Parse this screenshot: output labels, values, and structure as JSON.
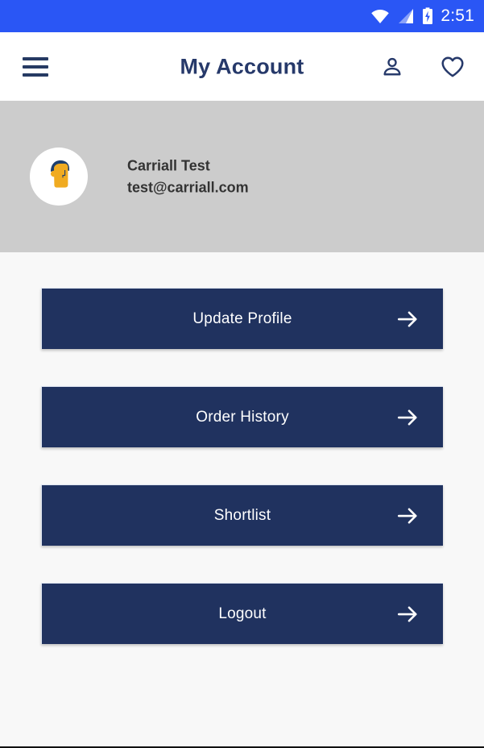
{
  "status_bar": {
    "background": "#2a56f5",
    "time": "2:51",
    "icons": [
      "wifi-icon",
      "cellular-signal-icon",
      "battery-charging-icon"
    ]
  },
  "app_bar": {
    "menu_icon": "hamburger-menu-icon",
    "title": "My Account",
    "title_color": "#26396a",
    "actions": [
      {
        "name": "account-icon",
        "label": "Account"
      },
      {
        "name": "favorites-heart-icon",
        "label": "Favorites"
      }
    ]
  },
  "profile": {
    "background": "#cccccc",
    "avatar_icon": "user-avatar-illustration",
    "avatar_colors": {
      "hair": "#1d3f6e",
      "face": "#f0ab21"
    },
    "name": "Carriall Test",
    "email": "test@carriall.com"
  },
  "menu": {
    "button_color": "#20325f",
    "arrow_icon": "arrow-right-icon",
    "items": [
      {
        "label": "Update Profile"
      },
      {
        "label": "Order History"
      },
      {
        "label": "Shortlist"
      },
      {
        "label": "Logout"
      }
    ]
  }
}
